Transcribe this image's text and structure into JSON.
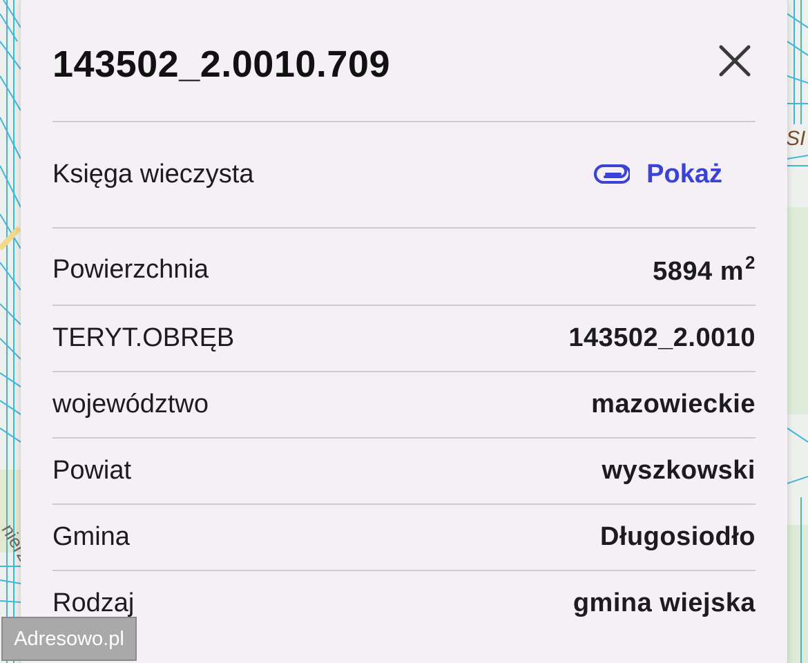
{
  "parcel": {
    "id": "143502_2.0010.709"
  },
  "rows": {
    "ksiega": {
      "label": "Księga wieczysta",
      "link_label": "Pokaż"
    },
    "powierzchnia": {
      "label": "Powierzchnia",
      "value": "5894 m",
      "unit_exponent": "2"
    },
    "teryt": {
      "label": "TERYT.OBRĘB",
      "value": "143502_2.0010"
    },
    "wojewodztwo": {
      "label": "województwo",
      "value": "mazowieckie"
    },
    "powiat": {
      "label": "Powiat",
      "value": "wyszkowski"
    },
    "gmina": {
      "label": "Gmina",
      "value": "Długosiodło"
    },
    "rodzaj": {
      "label": "Rodzaj",
      "value": "gmina wiejska"
    }
  },
  "attribution": "Adresowo.pl",
  "map_fragments": {
    "right_label": "SI",
    "left_label": "nierz"
  },
  "icons": {
    "close": "close-icon",
    "attachment": "paperclip-icon"
  },
  "colors": {
    "panel_bg": "#f5f0f6",
    "link": "#3b42d6",
    "divider": "#cfcad2",
    "map_lines": "#3fb7d8"
  }
}
